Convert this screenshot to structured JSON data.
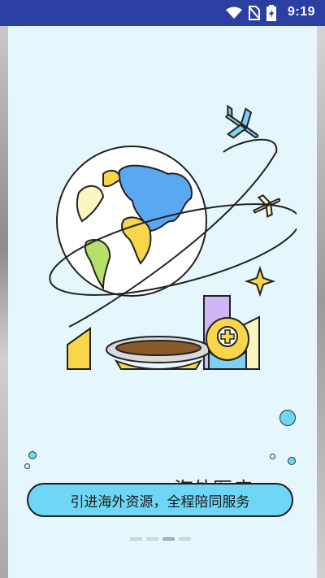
{
  "status_bar": {
    "time": "9:19",
    "icons": [
      "wifi-icon",
      "no-sim-icon",
      "battery-charging-icon"
    ]
  },
  "onboarding": {
    "title": "海外医疗",
    "cta_label": "引进海外资源，全程陪同服务",
    "page_indicator": {
      "total": 4,
      "active_index": 2
    }
  },
  "colors": {
    "status_bar": "#2b3fa3",
    "background": "#e6f6fd",
    "cta_fill": "#6fd6f5",
    "accent_yellow": "#f7d64a",
    "accent_blue": "#5aa8f0"
  }
}
